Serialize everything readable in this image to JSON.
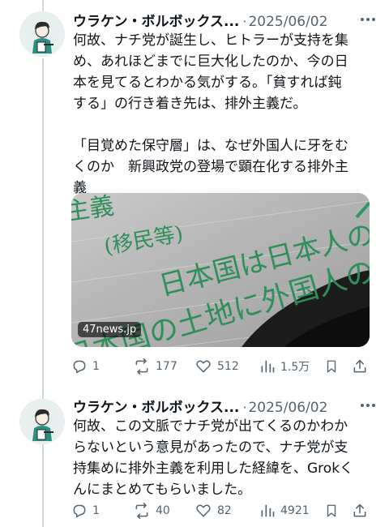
{
  "posts": [
    {
      "author": "ウラケン・ボルボックス...",
      "separator": "·",
      "date": "2025/06/02",
      "text_lines": [
        "何故、ナチ党が誕生し、ヒトラーが支持を集",
        "め、あれほどまでに巨大化したのか、今の日",
        "本を見てるとわかる気がする。「貧すれば鈍",
        "する」の行き着き先は、排外主義だ。",
        "",
        "「目覚めた保守層」は、なぜ外国人に牙をむ",
        "くのか　新興政党の登場で顕在化する排外主",
        "義"
      ],
      "card": {
        "source": "47news.jp",
        "image_lines": [
          "主義",
          "(移民等)",
          "日本国は日本人のもの",
          "日本国の土地に外国人の所"
        ]
      },
      "actions": {
        "reply": "1",
        "repost": "177",
        "like": "512",
        "views": "1.5万"
      }
    },
    {
      "author": "ウラケン・ボルボックス...",
      "separator": "·",
      "date": "2025/06/02",
      "text_lines": [
        "何故、この文脈でナチ党が出てくるのかわか",
        "らないという意見があったので、ナチ党が支",
        "持集めに排外主義を利用した経緯を、Grokく",
        "んにまとめてもらいました。"
      ],
      "actions": {
        "reply": "1",
        "repost": "40",
        "like": "82",
        "views": "4921"
      }
    }
  ],
  "icons": {
    "reply": "reply-icon",
    "repost": "repost-icon",
    "like": "heart-icon",
    "views": "views-icon",
    "bookmark": "bookmark-icon",
    "share": "share-icon",
    "more": "more-dots-icon"
  },
  "colors": {
    "text": "#0f1419",
    "muted": "#536471",
    "thread": "#cfd9de",
    "ink": "#2f8f5a"
  }
}
